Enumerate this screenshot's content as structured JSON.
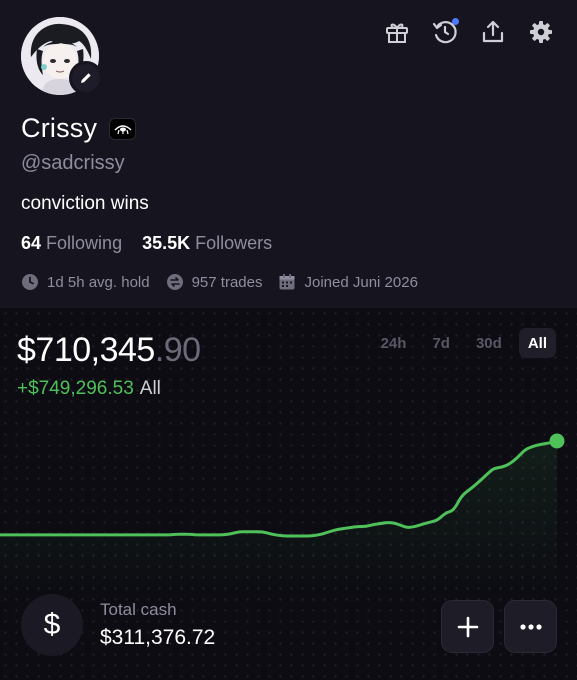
{
  "profile": {
    "name": "Crissy",
    "handle": "@sadcrissy",
    "bio": "conviction wins",
    "following_count": "64",
    "following_label": "Following",
    "followers_count": "35.5K",
    "followers_label": "Followers",
    "avg_hold": "1d 5h avg. hold",
    "trades": "957 trades",
    "joined": "Joined Juni 2026"
  },
  "toolbar": {
    "icons": [
      "gift-icon",
      "history-icon",
      "share-icon",
      "gear-icon"
    ]
  },
  "portfolio": {
    "balance_main": "$710,345",
    "balance_cents": ".90",
    "pnl_value": "+$749,296.53",
    "pnl_period": "All",
    "range_tabs": [
      "24h",
      "7d",
      "30d",
      "All"
    ],
    "active_range": "All"
  },
  "cash": {
    "icon_symbol": "$",
    "label": "Total cash",
    "value": "$311,376.72"
  },
  "colors": {
    "background": "#0c0c12",
    "profile_background": "#15141f",
    "gain_green": "#4fc15a",
    "muted_text": "#8f8d9e",
    "notification_dot": "#4b7bff"
  },
  "chart_data": {
    "type": "line",
    "series": [
      {
        "values": [
          1,
          1,
          1,
          1,
          1,
          1,
          1,
          1,
          1,
          1,
          1,
          1,
          1,
          1,
          1,
          1,
          1,
          1,
          1,
          1,
          1,
          1,
          1.5,
          1.8,
          1.5,
          1,
          1,
          1,
          1,
          2,
          4,
          4,
          4,
          4,
          2,
          0.5,
          0,
          0,
          0,
          0,
          1,
          3,
          5.5,
          7,
          8,
          9,
          9,
          11,
          12,
          13,
          11.5,
          8,
          8.5,
          11,
          13,
          15,
          22,
          24,
          38,
          44,
          50,
          57,
          64,
          65,
          68,
          74,
          82,
          85,
          87,
          88,
          90
        ]
      }
    ],
    "grid": true,
    "legend": "none"
  }
}
